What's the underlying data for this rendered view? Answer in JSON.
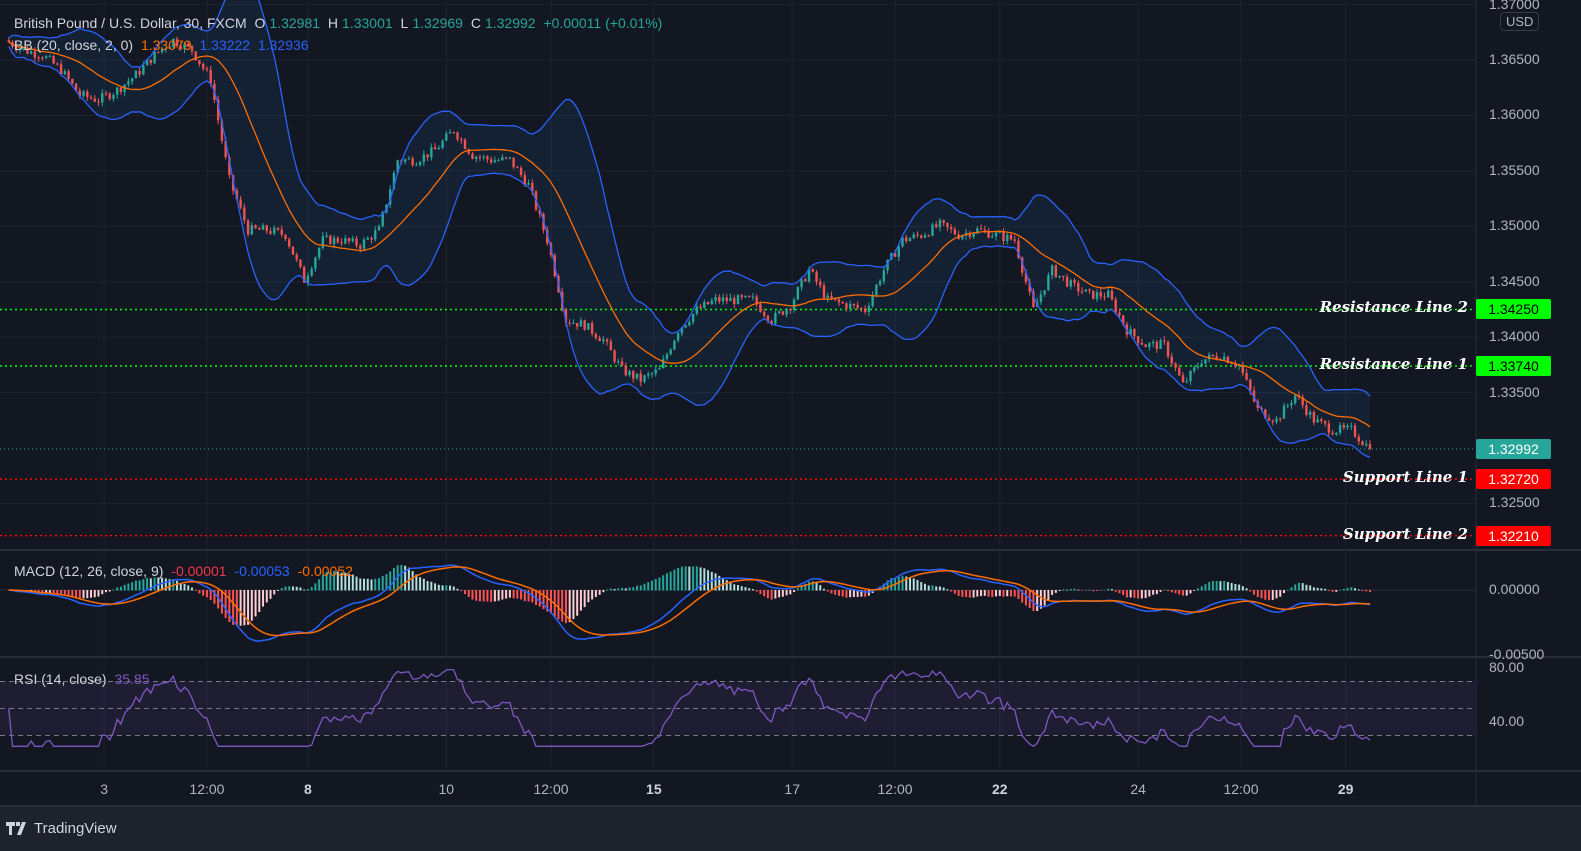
{
  "header": {
    "symbol": "British Pound / U.S. Dollar, 30, FXCM",
    "o_label": "O",
    "o": "1.32981",
    "h_label": "H",
    "h": "1.33001",
    "l_label": "L",
    "l": "1.32969",
    "c_label": "C",
    "c": "1.32992",
    "change": "+0.00011 (+0.01%)"
  },
  "bb_legend": {
    "label": "BB (20, close, 2, 0)",
    "basis": "1.33079",
    "upper": "1.33222",
    "lower": "1.32936"
  },
  "macd_legend": {
    "label": "MACD (12, 26, close, 9)",
    "hist": "-0.00001",
    "macd": "-0.00053",
    "signal": "-0.00052"
  },
  "rsi_legend": {
    "label": "RSI (14, close)",
    "value": "35.85"
  },
  "currency": "USD",
  "branding": "TradingView",
  "colors": {
    "up": "#26a69a",
    "down": "#ef5350",
    "bb_band": "#2962ff",
    "bb_basis": "#ff6d00",
    "macd": "#2962ff",
    "signal": "#ff6d00",
    "rsi": "#7e57c2",
    "resistance": "#00ff00",
    "support": "#ff0000",
    "last_price": "#26a69a"
  },
  "chart_data": {
    "type": "candlestick",
    "title": "British Pound / U.S. Dollar, 30, FXCM",
    "close_path": [
      1.3668,
      1.3659,
      1.36545,
      1.3641,
      1.36184,
      1.36139,
      1.36229,
      1.36365,
      1.36545,
      1.3668,
      1.3659,
      1.3632,
      1.35418,
      1.34967,
      1.34967,
      1.34922,
      1.34516,
      1.34876,
      1.34876,
      1.34831,
      1.34967,
      1.35598,
      1.35598,
      1.35688,
      1.35869,
      1.35643,
      1.35598,
      1.35598,
      1.35373,
      1.34876,
      1.34155,
      1.3411,
      1.33974,
      1.33704,
      1.33614,
      1.33704,
      1.34065,
      1.34245,
      1.34335,
      1.34335,
      1.34335,
      1.34155,
      1.3429,
      1.34606,
      1.34335,
      1.3429,
      1.34245,
      1.34606,
      1.34876,
      1.34922,
      1.35012,
      1.34922,
      1.34967,
      1.34922,
      1.34876,
      1.34245,
      1.34606,
      1.34471,
      1.34381,
      1.34381,
      1.34065,
      1.33929,
      1.33929,
      1.33569,
      1.33794,
      1.33839,
      1.33749,
      1.33343,
      1.33253,
      1.33478,
      1.33253,
      1.33163,
      1.33163,
      1.32992
    ],
    "price_axis": {
      "min": 1.3205,
      "max": 1.3705,
      "ticks": [
        "1.37000",
        "1.36500",
        "1.36000",
        "1.35500",
        "1.35000",
        "1.34500",
        "1.34000",
        "1.33500",
        "1.32500"
      ]
    },
    "x_ticks": [
      {
        "label": "3",
        "bold": false,
        "index": 5.3
      },
      {
        "label": "12:00",
        "bold": false,
        "index": 10.8
      },
      {
        "label": "8",
        "bold": true,
        "index": 16.2
      },
      {
        "label": "10",
        "bold": false,
        "index": 23.6
      },
      {
        "label": "12:00",
        "bold": false,
        "index": 29.2
      },
      {
        "label": "15",
        "bold": true,
        "index": 34.7
      },
      {
        "label": "17",
        "bold": false,
        "index": 42.1
      },
      {
        "label": "12:00",
        "bold": false,
        "index": 47.6
      },
      {
        "label": "22",
        "bold": true,
        "index": 53.2
      },
      {
        "label": "24",
        "bold": false,
        "index": 60.6
      },
      {
        "label": "12:00",
        "bold": false,
        "index": 66.1
      },
      {
        "label": "29",
        "bold": true,
        "index": 71.7
      }
    ],
    "levels": [
      {
        "label": "Resistance Line 2",
        "value": "1.34250",
        "kind": "resistance"
      },
      {
        "label": "Resistance Line 1",
        "value": "1.33740",
        "kind": "resistance"
      },
      {
        "label": "",
        "value": "1.32992",
        "kind": "last_price"
      },
      {
        "label": "Support Line 1",
        "value": "1.32720",
        "kind": "support"
      },
      {
        "label": "Support Line 2",
        "value": "1.32210",
        "kind": "support"
      }
    ],
    "macd_axis": {
      "ticks": [
        "0.00000",
        "-0.00500"
      ]
    },
    "rsi_axis": {
      "ticks": [
        "80.00",
        "40.00"
      ],
      "bands": [
        70,
        50,
        30
      ]
    }
  }
}
